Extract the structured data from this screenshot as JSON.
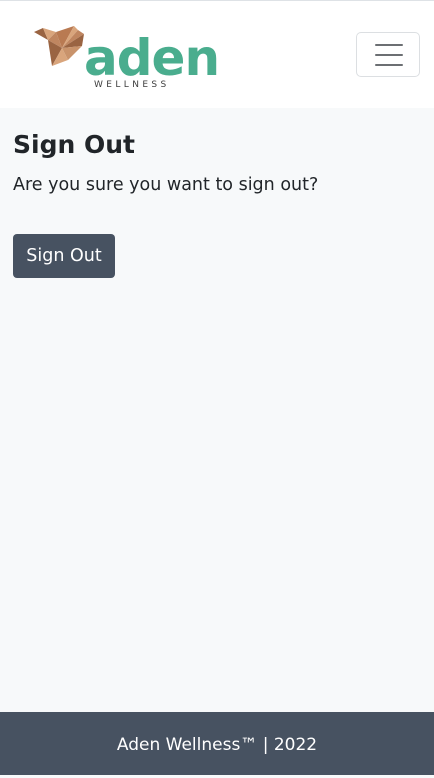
{
  "brand": {
    "name": "aden",
    "tagline": "WELLNESS",
    "colors": {
      "wordmark": "#4aad8e",
      "tagline": "#3d3d3d",
      "bird_light": "#d9a57c",
      "bird_mid": "#c08660",
      "bird_dark": "#9a6442"
    },
    "icon": "origami-bird-icon"
  },
  "navbar": {
    "toggler_icon": "hamburger-menu-icon"
  },
  "page": {
    "title": "Sign Out",
    "message": "Are you sure you want to sign out?",
    "button_label": "Sign Out",
    "button_color": "#475261"
  },
  "footer": {
    "text": "Aden Wellness™ | 2022",
    "background": "#475261"
  }
}
